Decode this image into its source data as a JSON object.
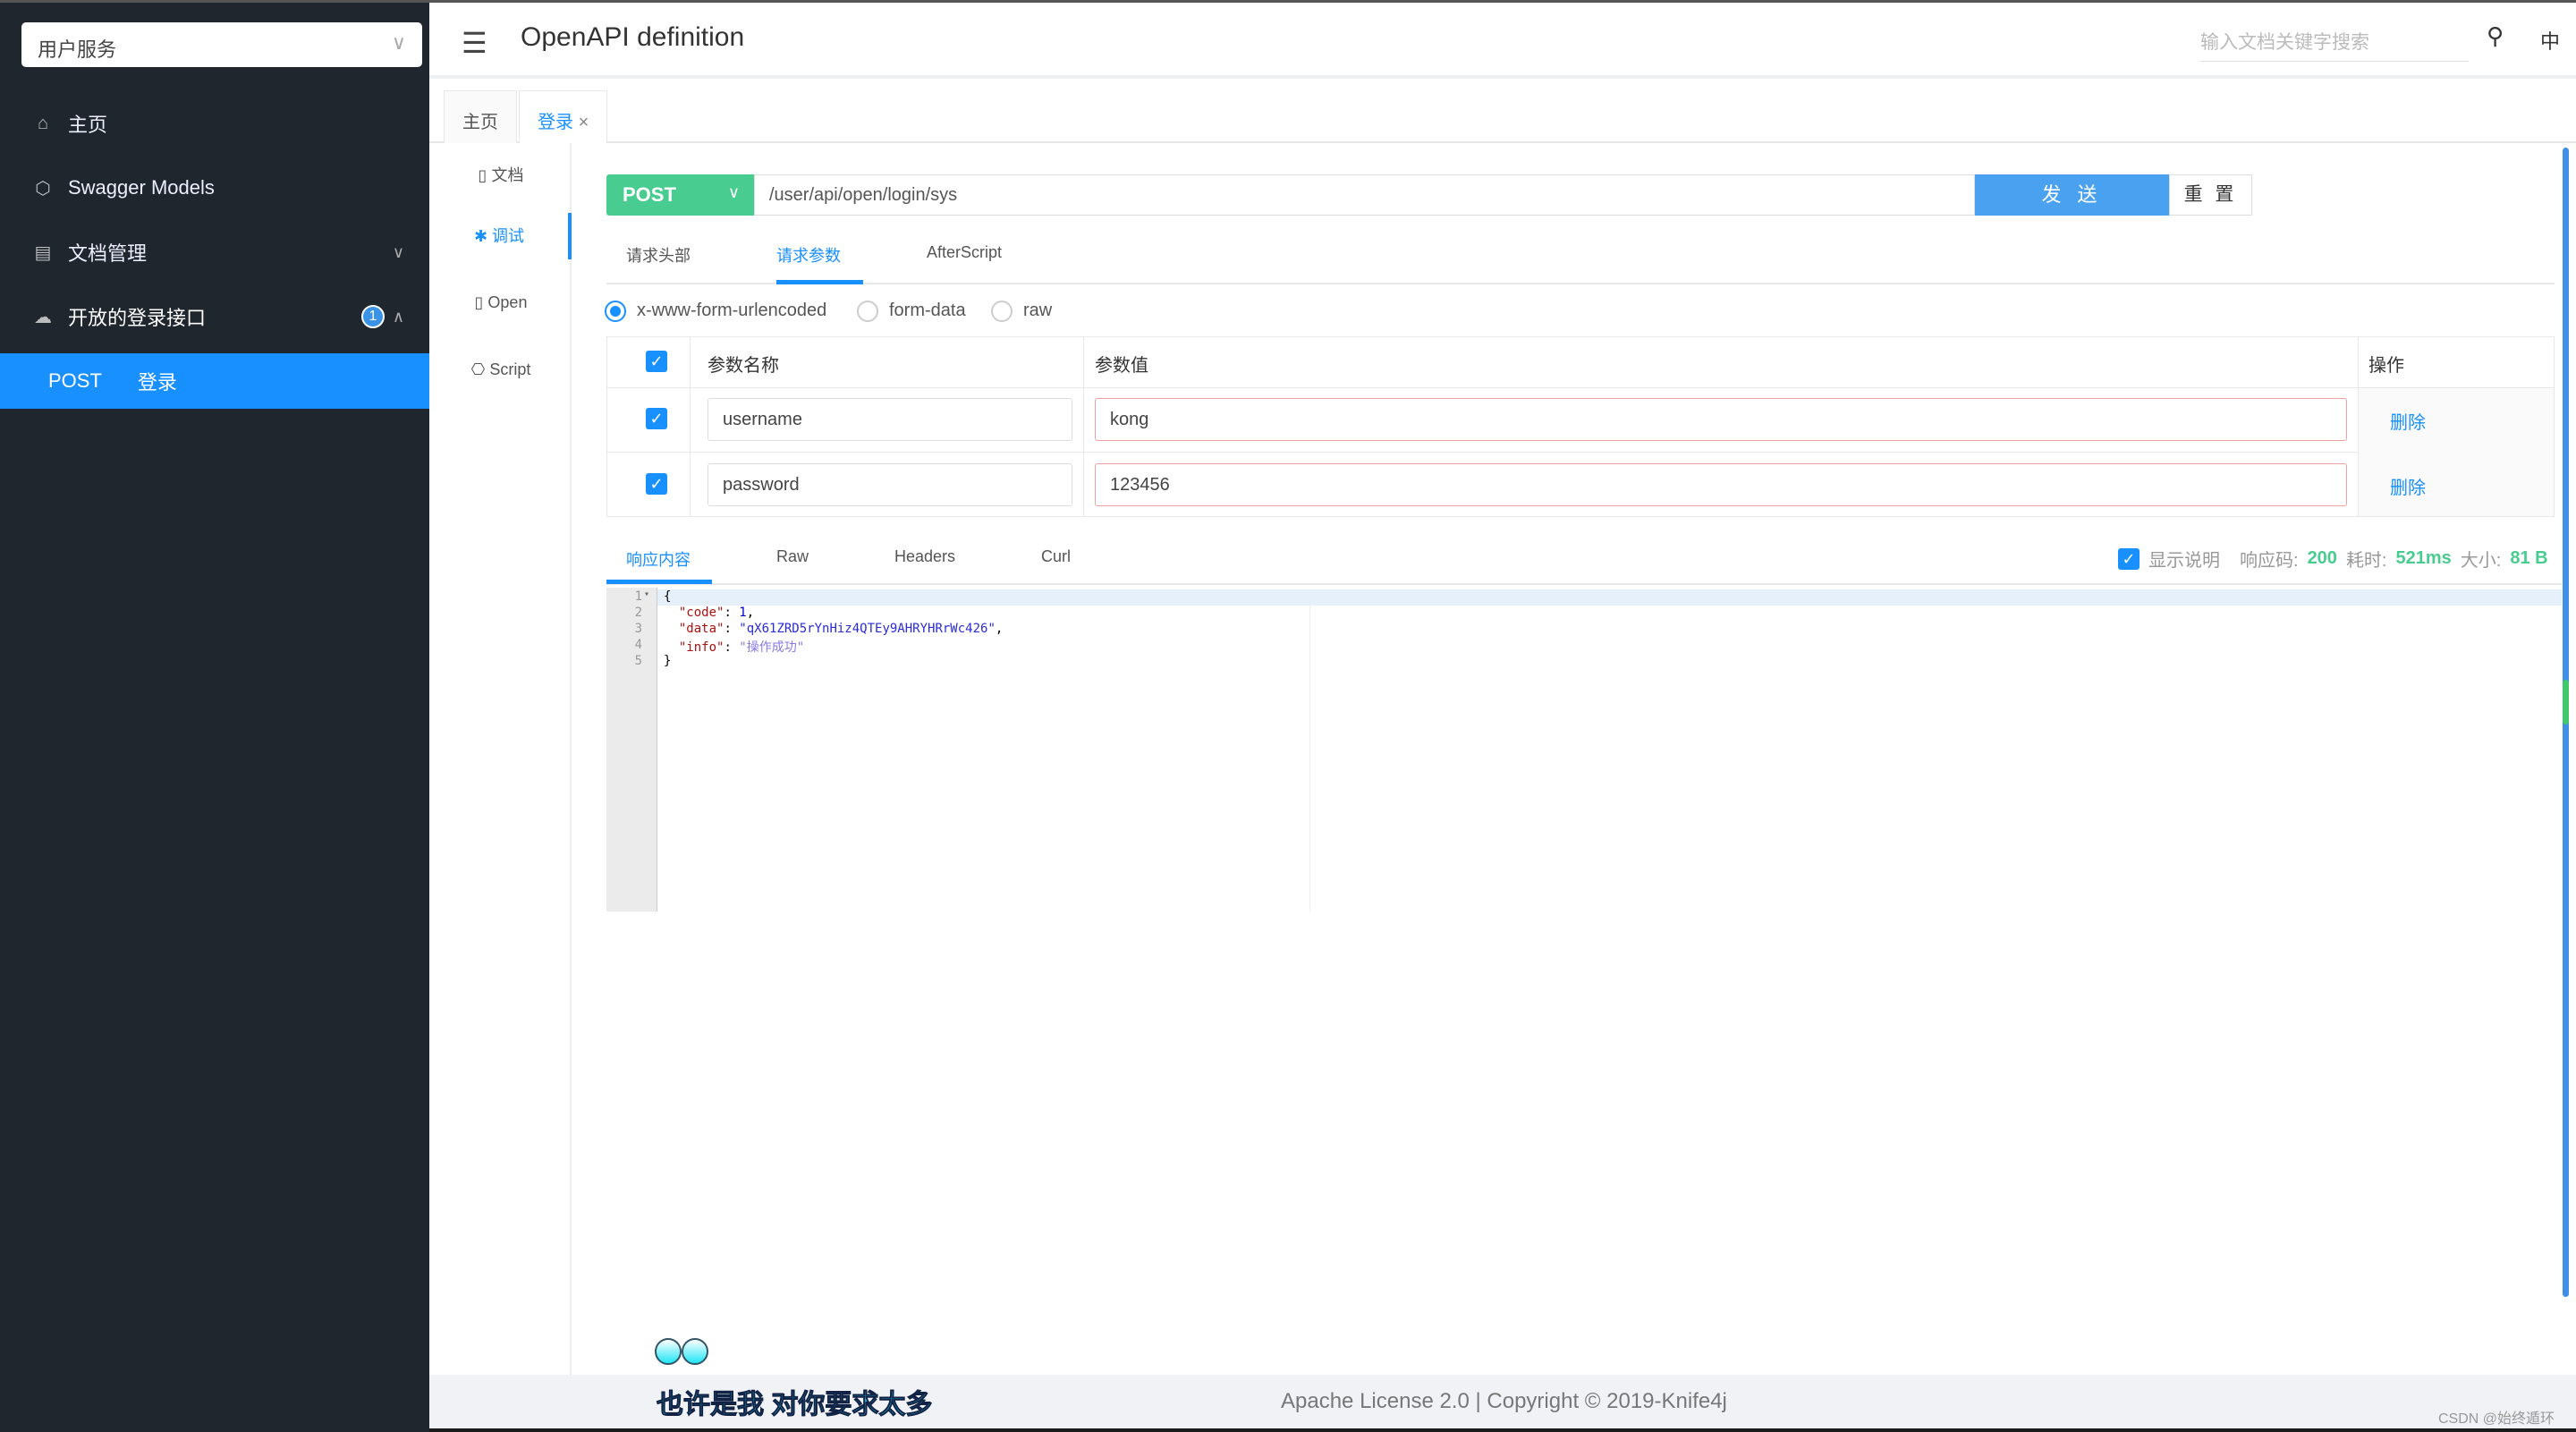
{
  "sidebar": {
    "service": "用户服务",
    "items": [
      {
        "label": "主页",
        "icon": "home-icon"
      },
      {
        "label": "Swagger Models",
        "icon": "cube-icon"
      },
      {
        "label": "文档管理",
        "icon": "doc-settings-icon"
      },
      {
        "label": "开放的登录接口",
        "icon": "cloud-api-icon",
        "badge": "1"
      }
    ],
    "active": {
      "method": "POST",
      "label": "登录"
    }
  },
  "header": {
    "title": "OpenAPI definition",
    "search_placeholder": "输入文档关键字搜索",
    "lang": "中"
  },
  "tabs": [
    {
      "label": "主页"
    },
    {
      "label": "登录",
      "close": "×"
    }
  ],
  "subnav": [
    {
      "label": "文档"
    },
    {
      "label": "调试"
    },
    {
      "label": "Open"
    },
    {
      "label": "Script"
    }
  ],
  "request": {
    "method": "POST",
    "url": "/user/api/open/login/sys",
    "send": "发 送",
    "reset": "重 置",
    "tabs": [
      "请求头部",
      "请求参数",
      "AfterScript"
    ],
    "content_types": [
      "x-www-form-urlencoded",
      "form-data",
      "raw"
    ],
    "columns": [
      "参数名称",
      "参数值",
      "操作"
    ],
    "params": [
      {
        "name": "username",
        "value": "kong",
        "action": "删除"
      },
      {
        "name": "password",
        "value": "123456",
        "action": "删除"
      }
    ]
  },
  "response": {
    "tabs": [
      "响应内容",
      "Raw",
      "Headers",
      "Curl"
    ],
    "show_desc": "显示说明",
    "code_label": "响应码:",
    "code": "200",
    "time_label": "耗时:",
    "time": "521ms",
    "size_label": "大小:",
    "size": "81 B",
    "lines": [
      "1",
      "2",
      "3",
      "4",
      "5"
    ],
    "key_code": "\"code\"",
    "val_code": "1",
    "key_data": "\"data\"",
    "val_data": "\"qX61ZRD5rYnHiz4QTEy9AHRYHRrWc426\"",
    "key_info": "\"info\"",
    "val_info": "\"操作成功\""
  },
  "footer": {
    "text": "Apache License 2.0 | Copyright © 2019-Knife4j",
    "slogan": "也许是我 对你要求太多",
    "watermark": "CSDN @始终遁环"
  },
  "colors": {
    "sidebar": "#1f262e",
    "accent": "#1890ff",
    "post": "#49cc90"
  }
}
